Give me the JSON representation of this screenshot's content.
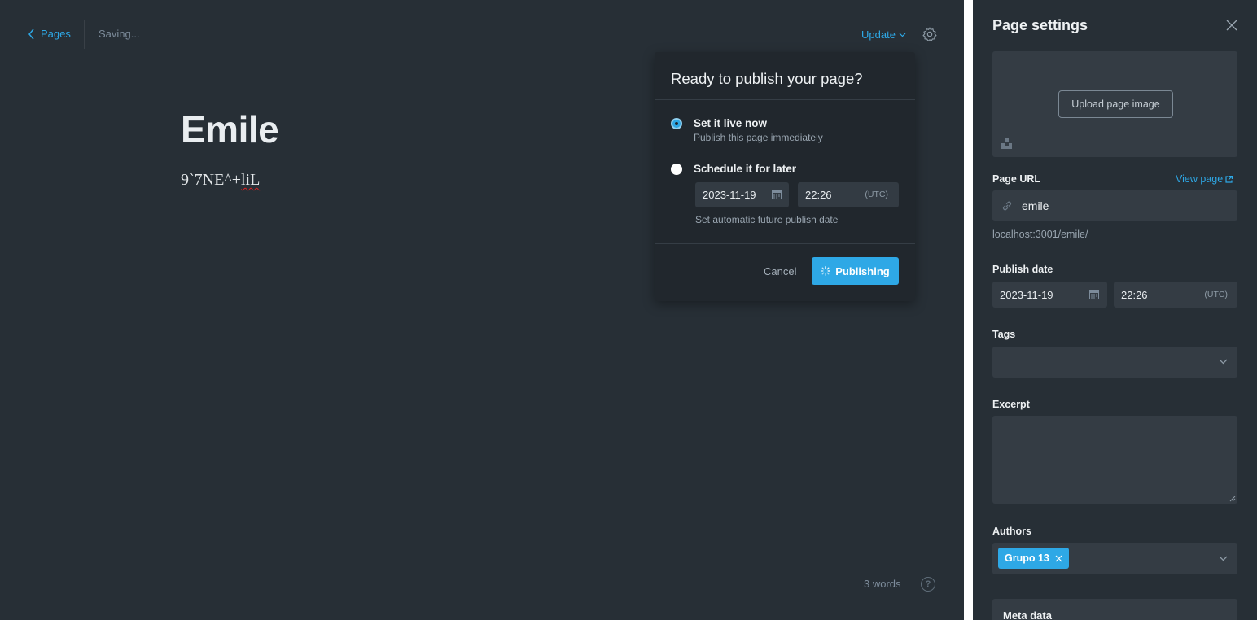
{
  "editor": {
    "back_label": "Pages",
    "status": "Saving...",
    "update_label": "Update",
    "title": "Emile",
    "body_plain": "9`7NE^+",
    "body_misspelled": "liL",
    "word_count": "3 words",
    "help_symbol": "?"
  },
  "publish_popover": {
    "heading": "Ready to publish your page?",
    "options": [
      {
        "title": "Set it live now",
        "subtitle": "Publish this page immediately",
        "selected": true
      },
      {
        "title": "Schedule it for later",
        "selected": false
      }
    ],
    "date": "2023-11-19",
    "time": "22:26",
    "timezone": "(UTC)",
    "hint": "Set automatic future publish date",
    "cancel_label": "Cancel",
    "publish_label": "Publishing"
  },
  "settings": {
    "title": "Page settings",
    "upload_label": "Upload page image",
    "url_label": "Page URL",
    "view_page_label": "View page",
    "slug": "emile",
    "url_hint": "localhost:3001/emile/",
    "publish_date_label": "Publish date",
    "date": "2023-11-19",
    "time": "22:26",
    "timezone": "(UTC)",
    "tags_label": "Tags",
    "excerpt_label": "Excerpt",
    "authors_label": "Authors",
    "authors": [
      "Grupo 13"
    ],
    "meta_label": "Meta data"
  },
  "colors": {
    "background": "#272f36",
    "accent": "#2ea8e6",
    "field": "#343c44",
    "popover": "#21272d"
  }
}
